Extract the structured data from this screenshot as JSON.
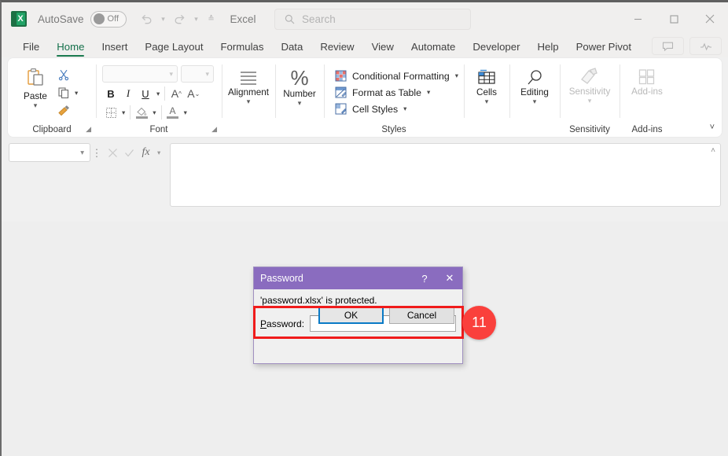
{
  "window": {
    "app_name": "Excel",
    "autosave_label": "AutoSave",
    "autosave_state": "Off",
    "minimize": "—",
    "maximize": "☐",
    "close": "✕",
    "logo_text": "X"
  },
  "search": {
    "placeholder": "Search",
    "icon": "search-icon"
  },
  "quick_access": {
    "undo": "undo-icon",
    "redo": "redo-icon",
    "customize": "customize-quick-access-icon"
  },
  "tabs": [
    {
      "label": "File",
      "active": false
    },
    {
      "label": "Home",
      "active": true
    },
    {
      "label": "Insert",
      "active": false
    },
    {
      "label": "Page Layout",
      "active": false
    },
    {
      "label": "Formulas",
      "active": false
    },
    {
      "label": "Data",
      "active": false
    },
    {
      "label": "Review",
      "active": false
    },
    {
      "label": "View",
      "active": false
    },
    {
      "label": "Automate",
      "active": false
    },
    {
      "label": "Developer",
      "active": false
    },
    {
      "label": "Help",
      "active": false
    },
    {
      "label": "Power Pivot",
      "active": false
    }
  ],
  "tab_right": {
    "comments": "comment-icon",
    "activity": "activity-icon"
  },
  "ribbon": {
    "collapse": "˅",
    "groups": [
      {
        "name": "Clipboard",
        "label": "Clipboard",
        "has_dialog_launcher": true,
        "paste_label": "Paste",
        "cut": "cut-icon",
        "copy": "copy-icon",
        "format_painter": "format-painter-icon"
      },
      {
        "name": "Font",
        "label": "Font",
        "has_dialog_launcher": true,
        "font_name_value": "",
        "font_size_value": "",
        "bold": "B",
        "italic": "I",
        "underline": "U",
        "grow_font": "A",
        "shrink_font": "A",
        "borders": "borders-icon",
        "fill_color": "fill-color-icon",
        "font_color": "font-color-icon"
      },
      {
        "name": "Alignment",
        "label": "Alignment",
        "button_label": "Alignment"
      },
      {
        "name": "Number",
        "label": "Number",
        "button_label": "Number",
        "icon": "percent-icon"
      },
      {
        "name": "Styles",
        "label": "Styles",
        "items": [
          {
            "label": "Conditional Formatting",
            "icon": "conditional-formatting-icon"
          },
          {
            "label": "Format as Table",
            "icon": "format-as-table-icon"
          },
          {
            "label": "Cell Styles",
            "icon": "cell-styles-icon"
          }
        ]
      },
      {
        "name": "Cells",
        "label": "",
        "button_label": "Cells",
        "icon": "cells-icon"
      },
      {
        "name": "Editing",
        "label": "",
        "button_label": "Editing",
        "icon": "editing-icon"
      },
      {
        "name": "Sensitivity",
        "label": "Sensitivity",
        "button_label": "Sensitivity",
        "icon": "sensitivity-icon",
        "disabled": true
      },
      {
        "name": "Add-ins",
        "label": "Add-ins",
        "button_label": "Add-ins",
        "icon": "add-ins-icon",
        "disabled": true
      }
    ]
  },
  "formula_bar": {
    "name_box_value": "",
    "cancel": "cancel-icon",
    "enter": "enter-icon",
    "insert_function": "fx",
    "value": "",
    "expand_toggle": "˄"
  },
  "dialog": {
    "title": "Password",
    "help_button": "?",
    "close_button": "✕",
    "message": "'password.xlsx' is protected.",
    "field_label_prefix": "P",
    "field_label_rest": "assword:",
    "password_value": "",
    "ok_label": "OK",
    "cancel_label": "Cancel"
  },
  "annotation": {
    "badge_number": "11",
    "badge_color": "#fa403c",
    "highlight_color": "#f01b1b"
  }
}
